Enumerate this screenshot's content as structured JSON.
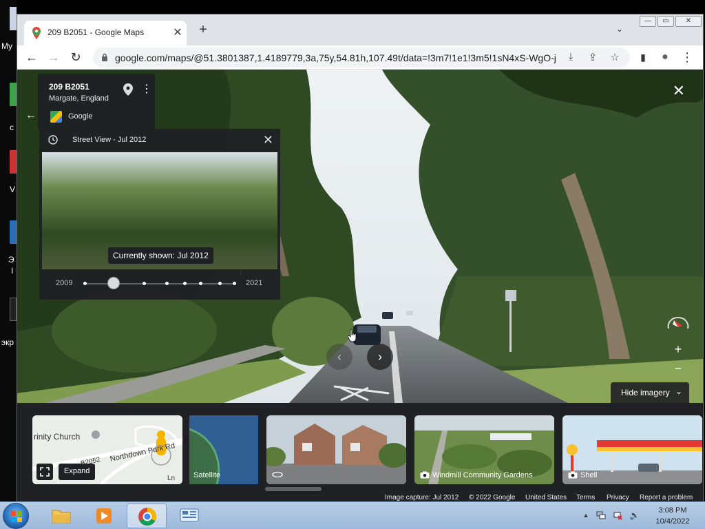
{
  "desktop": {
    "labels": [
      "My",
      "c",
      "V",
      "Э",
      "I",
      "экр"
    ]
  },
  "browser": {
    "tab_title": "209 B2051 - Google Maps",
    "tab_close": "✕",
    "new_tab": "+",
    "tab_menu": "⌄",
    "url": "google.com/maps/@51.3801387,1.4189779,3a,75y,54.81h,107.49t/data=!3m7!1e1!3m5!1sN4xS-WgO-j...",
    "nav": {
      "back": "←",
      "forward": "→",
      "reload": "↻"
    },
    "omnibox_icons": {
      "install": "⤓",
      "share": "⇪",
      "bookmark": "☆"
    },
    "toolbar_icons": {
      "sidepanel": "▮",
      "profile": "●",
      "menu": "⋮"
    },
    "window_controls": {
      "minimize": "—",
      "maximize": "▭",
      "close": "✕"
    }
  },
  "place": {
    "title": "209 B2051",
    "subtitle": "Margate, England",
    "source": "Google",
    "back": "←",
    "more": "⋮"
  },
  "time_machine": {
    "title": "Street View - Jul 2012",
    "close": "✕",
    "tooltip": "Currently shown: Jul 2012",
    "start_year": "2009",
    "end_year": "2021",
    "selected_fraction": 0.19
  },
  "controls": {
    "close_view": "✕",
    "zoom_in": "+",
    "zoom_out": "−",
    "prev": "‹",
    "next": "›",
    "hide_imagery": "Hide imagery",
    "hide_chevron": "⌄"
  },
  "strip": {
    "map_labels": {
      "church": "rinity Church",
      "road1": "B2052",
      "road2": "Northdown Park Rd",
      "road3": "Ln"
    },
    "expand": "Expand",
    "satellite": "Satellite",
    "cards": [
      "Windmill Community Gardens",
      "Shell"
    ]
  },
  "footer": {
    "image_capture": "Image capture: Jul 2012",
    "copyright": "© 2022 Google",
    "region": "United States",
    "terms": "Terms",
    "privacy": "Privacy",
    "report": "Report a problem"
  },
  "taskbar": {
    "time": "3:08 PM",
    "date": "10/4/2022",
    "tray_up": "▲",
    "volume": "🔊"
  }
}
